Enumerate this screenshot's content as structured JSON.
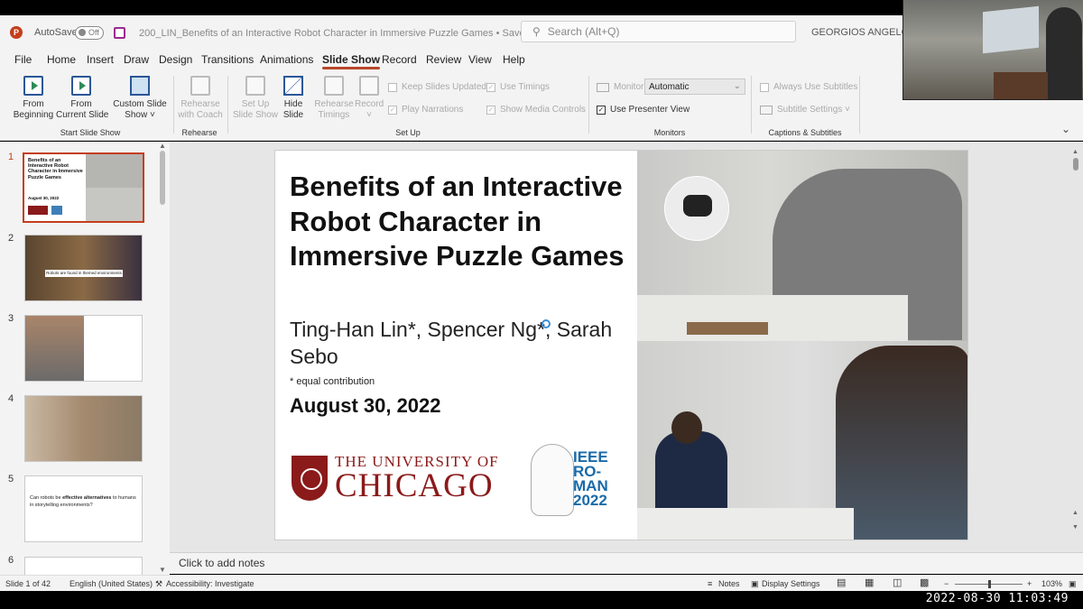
{
  "timestamp": "2022-08-30 11:03:49",
  "titlebar": {
    "autosave_label": "AutoSave",
    "autosave_state": "Off",
    "doc_title": "200_LIN_Benefits of an Interactive Robot Character in Immersive Puzzle Games • Saved to this PC ⌄",
    "search_placeholder": "Search (Alt+Q)",
    "user_name": "GEORGIOS ANGELOPOU"
  },
  "menu": [
    "File",
    "Home",
    "Insert",
    "Draw",
    "Design",
    "Transitions",
    "Animations",
    "Slide Show",
    "Record",
    "Review",
    "View",
    "Help"
  ],
  "menu_active": "Slide Show",
  "ribbon": {
    "from_beginning": "From\nBeginning",
    "from_current": "From\nCurrent Slide",
    "custom_show": "Custom Slide\nShow ˅",
    "group_start": "Start Slide Show",
    "rehearse_coach": "Rehearse\nwith Coach",
    "group_rehearse": "Rehearse",
    "setup_show": "Set Up\nSlide Show",
    "hide_slide": "Hide\nSlide",
    "rehearse_timings": "Rehearse\nTimings",
    "record": "Record\n˅",
    "keep_updated": "Keep Slides Updated",
    "use_timings": "Use Timings",
    "play_narrations": "Play Narrations",
    "show_media": "Show Media Controls",
    "group_setup": "Set Up",
    "monitor_label": "Monitor:",
    "monitor_value": "Automatic",
    "presenter_view": "Use Presenter View",
    "group_monitors": "Monitors",
    "always_subtitles": "Always Use Subtitles",
    "subtitle_settings": "Subtitle Settings ˅",
    "group_captions": "Captions & Subtitles"
  },
  "thumbnails": [
    {
      "num": "1",
      "lines": [
        "Benefits of an",
        "Interactive Robot",
        "Character in Immersive",
        "Puzzle Games"
      ],
      "date": "August 30, 2022"
    },
    {
      "num": "2",
      "caption": "Robots are found in themed environments"
    },
    {
      "num": "3"
    },
    {
      "num": "4"
    },
    {
      "num": "5",
      "text_pre": "Can robots be ",
      "text_bold": "effective alternatives",
      "text_post": " to humans in storytelling environments?"
    },
    {
      "num": "6"
    }
  ],
  "slide": {
    "title": "Benefits of an Interactive Robot Character in Immersive Puzzle Games",
    "authors": "Ting-Han Lin*, Spencer Ng*, Sarah Sebo",
    "note": "* equal contribution",
    "date": "August 30, 2022",
    "uchicago_line1": "THE UNIVERSITY OF",
    "uchicago_line2": "CHICAGO",
    "ieee_line1": "IEEE",
    "ieee_line2": "RO-MAN",
    "ieee_line3": "2022"
  },
  "notes_placeholder": "Click to add notes",
  "status": {
    "slide_count": "Slide 1 of 42",
    "language": "English (United States)",
    "accessibility": "Accessibility: Investigate",
    "notes": "Notes",
    "display_settings": "Display Settings",
    "zoom": "103%"
  }
}
